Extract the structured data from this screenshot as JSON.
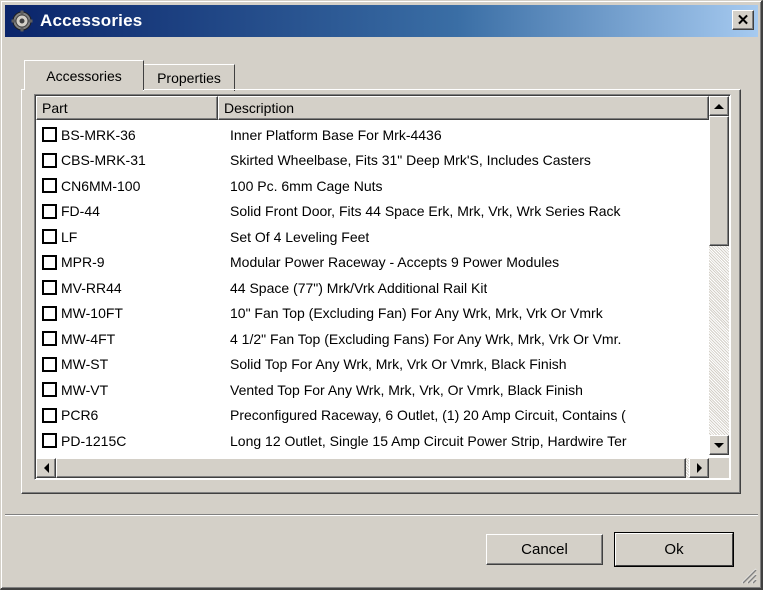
{
  "window": {
    "title": "Accessories",
    "icon": "app-gear-icon",
    "close_label": "✕"
  },
  "tabs": [
    {
      "label": "Accessories",
      "active": true
    },
    {
      "label": "Properties",
      "active": false
    }
  ],
  "list": {
    "columns": [
      "Part",
      "Description"
    ],
    "rows": [
      {
        "part": "BS-MRK-36",
        "desc": "Inner Platform Base For Mrk-4436",
        "checked": false
      },
      {
        "part": "CBS-MRK-31",
        "desc": "Skirted Wheelbase, Fits 31\" Deep Mrk'S, Includes Casters",
        "checked": false
      },
      {
        "part": "CN6MM-100",
        "desc": "100 Pc. 6mm Cage Nuts",
        "checked": false
      },
      {
        "part": "FD-44",
        "desc": "Solid Front Door, Fits 44 Space Erk, Mrk, Vrk, Wrk Series Rack",
        "checked": false
      },
      {
        "part": "LF",
        "desc": "Set Of 4 Leveling Feet",
        "checked": false
      },
      {
        "part": "MPR-9",
        "desc": "Modular Power Raceway - Accepts 9 Power Modules",
        "checked": false
      },
      {
        "part": "MV-RR44",
        "desc": "44 Space (77\") Mrk/Vrk Additional Rail Kit",
        "checked": false
      },
      {
        "part": "MW-10FT",
        "desc": "10\" Fan Top (Excluding Fan) For Any Wrk, Mrk, Vrk Or Vmrk",
        "checked": false
      },
      {
        "part": "MW-4FT",
        "desc": "4 1/2\" Fan Top (Excluding Fans) For Any Wrk, Mrk, Vrk Or Vmr.",
        "checked": false
      },
      {
        "part": "MW-ST",
        "desc": "Solid Top For Any Wrk, Mrk, Vrk Or Vmrk, Black Finish",
        "checked": false
      },
      {
        "part": "MW-VT",
        "desc": "Vented Top For Any Wrk, Mrk, Vrk, Or Vmrk, Black Finish",
        "checked": false
      },
      {
        "part": "PCR6",
        "desc": "Preconfigured Raceway, 6 Outlet, (1) 20 Amp Circuit, Contains (",
        "checked": false
      },
      {
        "part": "PD-1215C",
        "desc": "Long 12 Outlet, Single 15 Amp Circuit Power Strip, Hardwire Ter",
        "checked": false
      }
    ]
  },
  "buttons": {
    "cancel": "Cancel",
    "ok": "Ok"
  },
  "colors": {
    "title_start": "#0a246a",
    "title_end": "#a6caf0",
    "face": "#d4d0c8"
  }
}
